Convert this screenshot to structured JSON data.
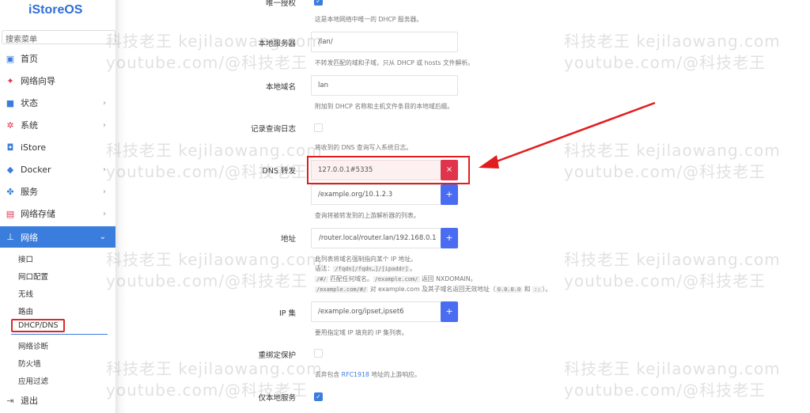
{
  "brand": "iStoreOS",
  "sidebar": {
    "search_placeholder": "搜索菜单",
    "items": [
      {
        "label": "首页",
        "icon": "dashboard-icon",
        "color": "#3b7ddd"
      },
      {
        "label": "网络向导",
        "icon": "wizard-icon",
        "color": "#e0334c"
      },
      {
        "label": "状态",
        "icon": "status-icon",
        "color": "#3b7ddd",
        "chevron": "›"
      },
      {
        "label": "系统",
        "icon": "gear-icon",
        "color": "#e0334c",
        "chevron": "›"
      },
      {
        "label": "iStore",
        "icon": "store-icon",
        "color": "#3b7ddd"
      },
      {
        "label": "Docker",
        "icon": "docker-icon",
        "color": "#3b7ddd",
        "chevron": "›"
      },
      {
        "label": "服务",
        "icon": "services-icon",
        "color": "#3b7ddd",
        "chevron": "›"
      },
      {
        "label": "网络存储",
        "icon": "storage-icon",
        "color": "#e0334c",
        "chevron": "›"
      },
      {
        "label": "网络",
        "icon": "network-icon",
        "color": "#ffffff",
        "chevron": "⌄"
      }
    ],
    "sub_items": [
      "接口",
      "网口配置",
      "无线",
      "路由",
      "DHCP/DNS",
      "网络诊断",
      "防火墙",
      "应用过滤"
    ],
    "logout": "退出"
  },
  "form": {
    "top_label": "唯一授权",
    "top_hint": "这是本地网络中唯一的 DHCP 服务器。",
    "local_server": {
      "label": "本地服务器",
      "value": "/lan/",
      "hint": "不转发匹配的域和子域，只从 DHCP 或 hosts 文件解析。"
    },
    "local_domain": {
      "label": "本地域名",
      "value": "lan",
      "hint": "附加到 DHCP 名称和主机文件条目的本地域后缀。"
    },
    "log_queries": {
      "label": "记录查询日志",
      "hint": "将收到的 DNS 查询写入系统日志。"
    },
    "dns_forward": {
      "label": "DNS 转发",
      "values": [
        "127.0.0.1#5335",
        "/example.org/10.1.2.3"
      ],
      "hint": "查询将被转发到的上游解析器的列表。",
      "remove_symbol": "×",
      "add_symbol": "+"
    },
    "address": {
      "label": "地址",
      "value": "/router.local/router.lan/192.168.0.1",
      "hint1": "此列表将域名强制指向某个 IP 地址。",
      "hint2_pre": "语法：",
      "hint2_code": "/fqdn[/fqdn…]/[ipaddr]",
      "hint2_post": "。",
      "hint3_code": "/#/",
      "hint3_mid": " 匹配任何域名。",
      "hint3_code2": "/example.com/",
      "hint3_post": " 返回 NXDOMAIN。",
      "hint4_code": "/example.com/#/",
      "hint4_mid": " 对 example.com 及其子域名返回无效地址（",
      "hint4_code2": "0.0.0.0",
      "hint4_and": " 和 ",
      "hint4_code3": "::",
      "hint4_post": "）。"
    },
    "ipset": {
      "label": "IP 集",
      "value": "/example.org/ipset,ipset6",
      "hint": "要用指定域 IP 填充的 IP 集列表。"
    },
    "rebind": {
      "label": "重绑定保护",
      "hint_pre": "丢弃包含 ",
      "hint_link": "RFC1918",
      "hint_post": " 地址的上游响应。"
    },
    "local_only": {
      "label": "仅本地服务"
    },
    "check_mark": "✓"
  },
  "watermark": {
    "line1": "科技老王 kejilaowang.com",
    "line2": "youtube.com/@科技老王"
  },
  "colors": {
    "accent": "#3b7ddd",
    "highlight": "#e21c1c",
    "add": "#4a6cf0",
    "remove": "#e0334c"
  }
}
